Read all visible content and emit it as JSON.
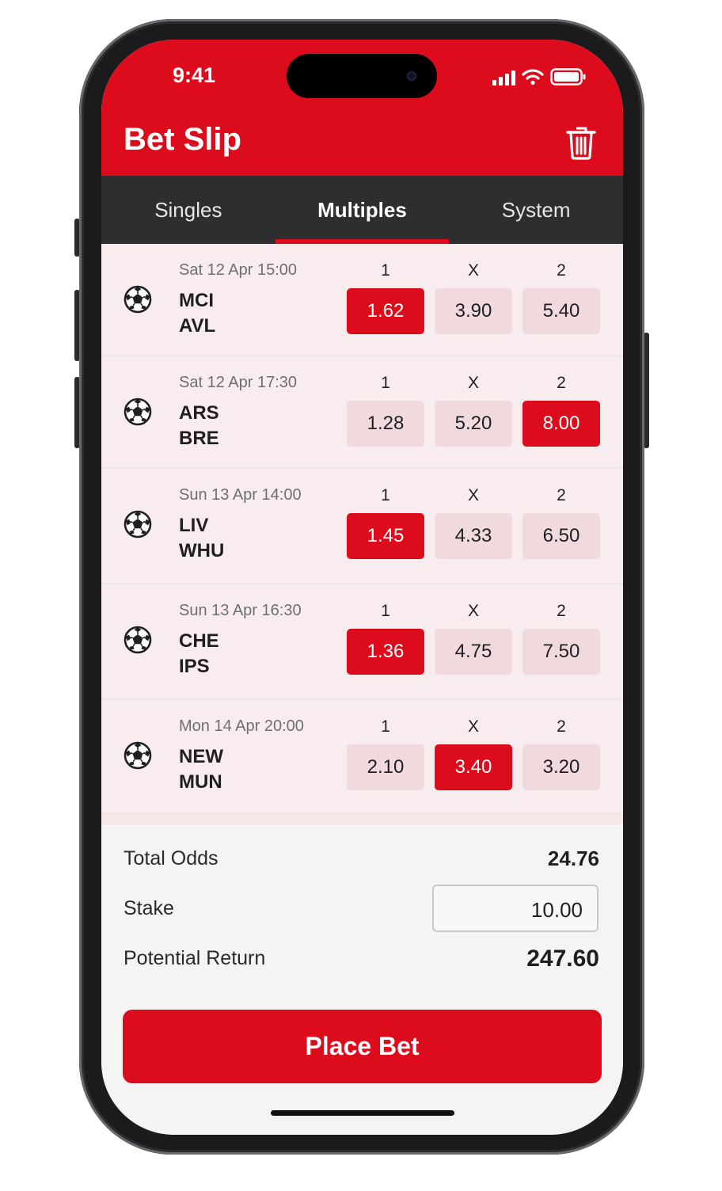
{
  "status": {
    "time": "9:41"
  },
  "header": {
    "title": "Bet Slip"
  },
  "tabs": [
    "Singles",
    "Multiples",
    "System"
  ],
  "active_tab": "Multiples",
  "market_headers": [
    "1",
    "X",
    "2"
  ],
  "events": [
    {
      "date": "Sat 12 Apr 15:00",
      "home": "MCI",
      "away": "AVL",
      "odds": [
        "1.62",
        "3.90",
        "5.40"
      ],
      "selected": 0
    },
    {
      "date": "Sat 12 Apr 17:30",
      "home": "ARS",
      "away": "BRE",
      "odds": [
        "1.28",
        "5.20",
        "8.00"
      ],
      "selected": 2
    },
    {
      "date": "Sun 13 Apr 14:00",
      "home": "LIV",
      "away": "WHU",
      "odds": [
        "1.45",
        "4.33",
        "6.50"
      ],
      "selected": 0
    },
    {
      "date": "Sun 13 Apr 16:30",
      "home": "CHE",
      "away": "IPS",
      "odds": [
        "1.36",
        "4.75",
        "7.50"
      ],
      "selected": 0
    },
    {
      "date": "Mon 14 Apr 20:00",
      "home": "NEW",
      "away": "MUN",
      "odds": [
        "2.10",
        "3.40",
        "3.20"
      ],
      "selected": 1
    }
  ],
  "summary": {
    "total_odds_label": "Total Odds",
    "total_odds": "24.76",
    "stake_label": "Stake",
    "stake": "10.00",
    "return_label": "Potential Return",
    "return": "247.60"
  },
  "place_bet_label": "Place Bet",
  "icons": {
    "sport": "soccer-ball-icon",
    "delete": "trash-icon"
  },
  "colors": {
    "brand": "#dc0c1c",
    "tab_bar": "#2e2e30"
  }
}
